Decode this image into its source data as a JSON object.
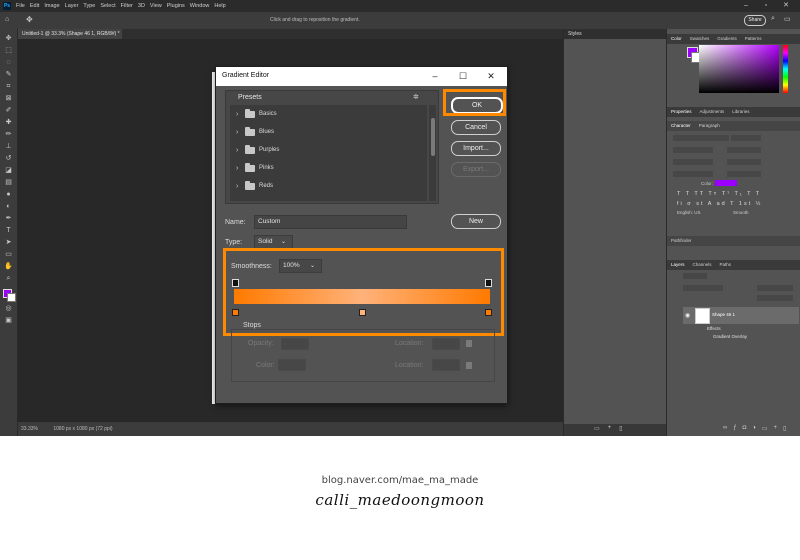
{
  "app": {
    "logo": "Ps",
    "menu": [
      "File",
      "Edit",
      "Image",
      "Layer",
      "Type",
      "Select",
      "Filter",
      "3D",
      "View",
      "Plugins",
      "Window",
      "Help"
    ],
    "options_hint": "Click and drag to reposition the gradient.",
    "share_label": "Share",
    "document_tab": "Untitled-1 @ 33.3% (Shape 46 1, RGB/8#) *",
    "zoom_status": "33.33%",
    "doc_size_status": "1080 px x 1080 px (72 ppi)",
    "styles_tab": "Styles"
  },
  "right_panels": {
    "color_tabs": [
      "Color",
      "Swatches",
      "Gradients",
      "Patterns"
    ],
    "props_tabs": [
      "Properties",
      "Adjustments",
      "Libraries"
    ],
    "char_tabs": [
      "Character",
      "Paragraph"
    ],
    "char_color_label": "Color:",
    "char_color": "#9b00ff",
    "english_lang": "English: US",
    "smooth_label": "Smooth",
    "pathfinder": "Pathfinder",
    "layers_tabs": [
      "Layers",
      "Channels",
      "Paths"
    ],
    "layer_name": "Shape 46 1",
    "effects_label": "Effects",
    "effect_item": "Gradient Overlay"
  },
  "dialog": {
    "title": "Gradient Editor",
    "presets_label": "Presets",
    "preset_folders": [
      "Basics",
      "Blues",
      "Purples",
      "Pinks",
      "Reds"
    ],
    "ok_label": "OK",
    "cancel_label": "Cancel",
    "import_label": "Import...",
    "export_label": "Export...",
    "name_label": "Name:",
    "name_value": "Custom",
    "new_label": "New",
    "type_label": "Type:",
    "type_value": "Solid",
    "smoothness_label": "Smoothness:",
    "smoothness_value": "100%",
    "stops_label": "Stops",
    "opacity_label": "Opacity:",
    "location_label": "Location:",
    "color_label": "Color:",
    "gradient_colors": [
      "#ff7a00",
      "#ffb27a",
      "#ff7a00"
    ]
  },
  "footer": {
    "url": "blog.naver.com/mae_ma_made",
    "signature": "calli_maedoongmoon"
  },
  "highlight_color": "#ff8a00"
}
